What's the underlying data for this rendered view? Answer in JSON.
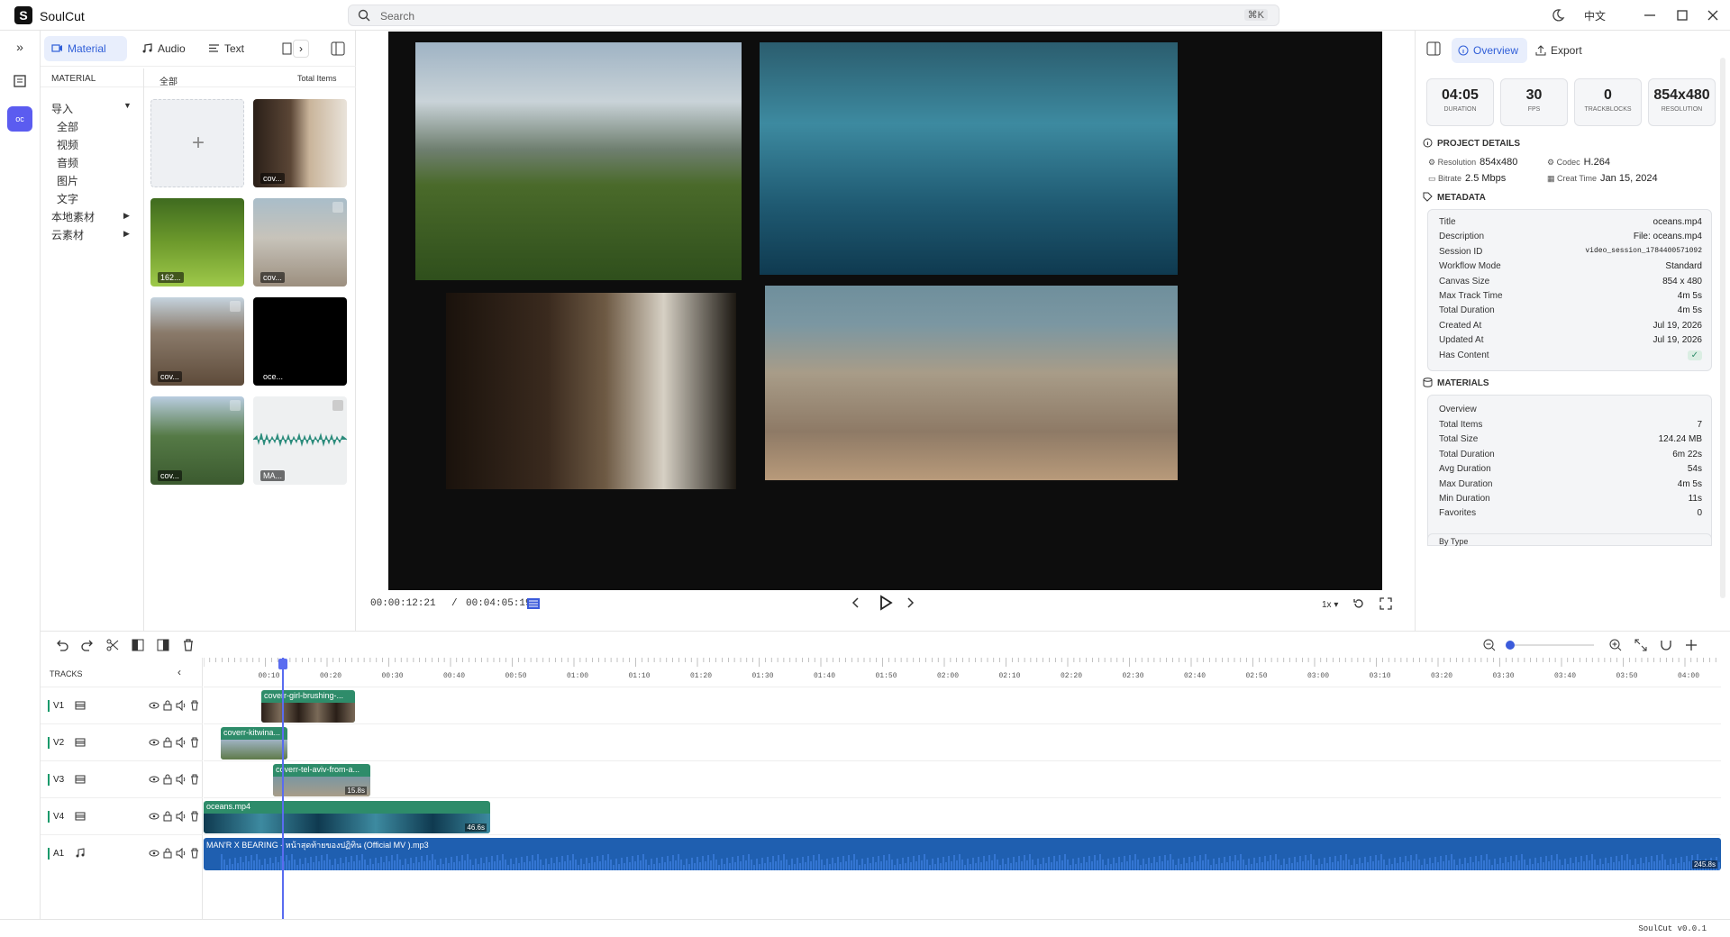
{
  "app": {
    "logo": "S",
    "name": "SoulCut",
    "version": "SoulCut v0.0.1"
  },
  "search": {
    "placeholder": "Search",
    "shortcut": "⌘K"
  },
  "titlebar": {
    "language": "中文"
  },
  "material": {
    "tabs": [
      "Material",
      "Audio",
      "Text"
    ],
    "active_tab": "Material",
    "header_left": "MATERIAL",
    "header_mid": "全部",
    "header_right": "Total Items",
    "tree": [
      {
        "label": "导入",
        "arrow": "▼"
      },
      {
        "label": "全部"
      },
      {
        "label": "视频"
      },
      {
        "label": "音频"
      },
      {
        "label": "图片"
      },
      {
        "label": "文字"
      },
      {
        "label": "本地素材",
        "arrow": "▶"
      },
      {
        "label": "云素材",
        "arrow": "▶"
      }
    ],
    "tiles": [
      {
        "cap": "",
        "kind": "add"
      },
      {
        "cap": "cov...",
        "kind": "girl"
      },
      {
        "cap": "162...",
        "kind": "forest"
      },
      {
        "cap": "cov...",
        "kind": "city"
      },
      {
        "cap": "cov...",
        "kind": "mountain"
      },
      {
        "cap": "oce...",
        "kind": "black"
      },
      {
        "cap": "cov...",
        "kind": "river"
      },
      {
        "cap": "MA...",
        "kind": "audio"
      }
    ]
  },
  "player": {
    "current": "00:00:12:21",
    "sep": "/",
    "total": "00:04:05:19",
    "speed": "1x ▾"
  },
  "overview": {
    "tabs": {
      "overview": "Overview",
      "export": "Export"
    },
    "stats": [
      {
        "value": "04:05",
        "label": "Duration"
      },
      {
        "value": "30",
        "label": "FPS"
      },
      {
        "value": "0",
        "label": "Trackblocks"
      },
      {
        "value": "854x480",
        "label": "Resolution"
      }
    ],
    "project_details_title": "PROJECT DETAILS",
    "project_details": {
      "resolution_k": "Resolution",
      "resolution_v": "854x480",
      "codec_k": "Codec",
      "codec_v": "H.264",
      "bitrate_k": "Bitrate",
      "bitrate_v": "2.5 Mbps",
      "created_k": "Creat Time",
      "created_v": "Jan 15, 2024"
    },
    "metadata_title": "METADATA",
    "metadata": [
      {
        "k": "Title",
        "v": "oceans.mp4"
      },
      {
        "k": "Description",
        "v": "File: oceans.mp4"
      },
      {
        "k": "Session ID",
        "v": "video_session_1784400571092"
      },
      {
        "k": "Workflow Mode",
        "v": "Standard"
      },
      {
        "k": "Canvas Size",
        "v": "854 x 480"
      },
      {
        "k": "Max Track Time",
        "v": "4m 5s"
      },
      {
        "k": "Total Duration",
        "v": "4m 5s"
      },
      {
        "k": "Created At",
        "v": "Jul 19, 2026"
      },
      {
        "k": "Updated At",
        "v": "Jul 19, 2026"
      },
      {
        "k": "Has Content",
        "v": "✓"
      }
    ],
    "materials_title": "MATERIALS",
    "materials_sub": "Overview",
    "materials": [
      {
        "k": "Total Items",
        "v": "7"
      },
      {
        "k": "Total Size",
        "v": "124.24 MB"
      },
      {
        "k": "Total Duration",
        "v": "6m 22s"
      },
      {
        "k": "Avg Duration",
        "v": "54s"
      },
      {
        "k": "Max Duration",
        "v": "4m 5s"
      },
      {
        "k": "Min Duration",
        "v": "11s"
      },
      {
        "k": "Favorites",
        "v": "0"
      }
    ],
    "by_type": "By Type"
  },
  "timeline": {
    "tracks_label": "TRACKS",
    "ruler": [
      "00:10",
      "00:20",
      "00:30",
      "00:40",
      "00:50",
      "01:00",
      "01:10",
      "01:20",
      "01:30",
      "01:40",
      "01:50",
      "02:00",
      "02:10",
      "02:20",
      "02:30",
      "02:40",
      "02:50",
      "03:00",
      "03:10",
      "03:20",
      "03:30",
      "03:40",
      "03:50",
      "04:00"
    ],
    "tracks": [
      {
        "name": "V1",
        "type": "video"
      },
      {
        "name": "V2",
        "type": "video"
      },
      {
        "name": "V3",
        "type": "video"
      },
      {
        "name": "V4",
        "type": "video"
      },
      {
        "name": "A1",
        "type": "audio"
      }
    ],
    "clips": [
      {
        "label": "coverr-girl-brushing-...",
        "dur": ""
      },
      {
        "label": "coverr-kitwina...",
        "dur": ""
      },
      {
        "label": "coverr-tel-aviv-from-a...",
        "dur": "15.8s"
      },
      {
        "label": "oceans.mp4",
        "dur": "46.6s"
      },
      {
        "label": "MAN'R X BEARING - หน้าสุดท้ายของปฏิทิน (Official MV ).mp3",
        "dur": "245.8s"
      }
    ]
  },
  "colors": {
    "accent": "#2f5ed8",
    "clip": "#2e8c6a",
    "audio": "#1f5fb0",
    "playhead": "#5a6cf0"
  }
}
